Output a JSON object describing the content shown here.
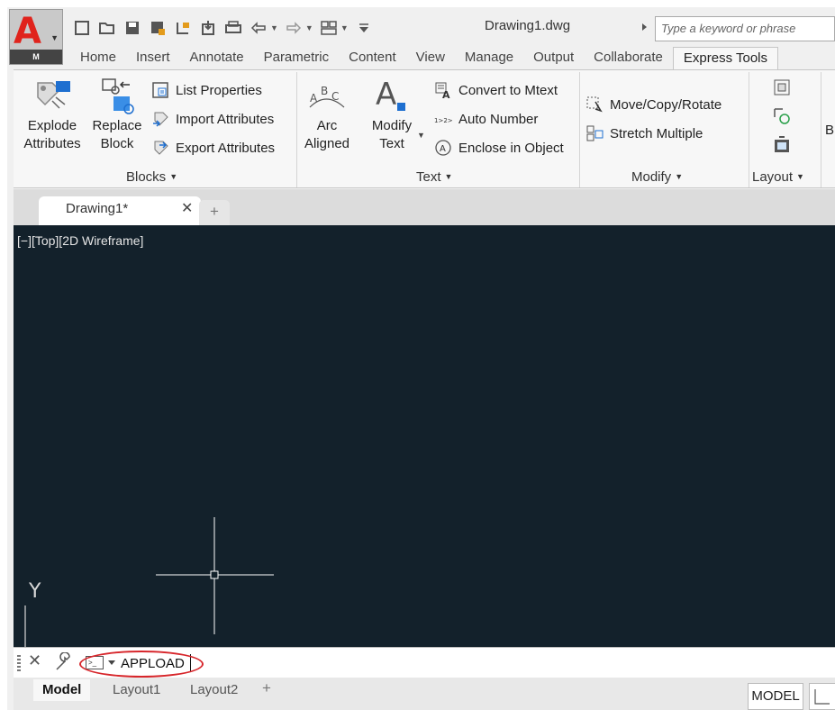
{
  "app": {
    "logo_letter": "A",
    "logo_badge": "M",
    "document_title": "Drawing1.dwg"
  },
  "search": {
    "placeholder": "Type a keyword or phrase"
  },
  "ribbon_tabs": [
    "Home",
    "Insert",
    "Annotate",
    "Parametric",
    "Content",
    "View",
    "Manage",
    "Output",
    "Collaborate",
    "Express Tools"
  ],
  "active_ribbon_tab": "Express Tools",
  "panels": {
    "blocks": {
      "title": "Blocks",
      "explode_line1": "Explode",
      "explode_line2": "Attributes",
      "replace_line1": "Replace",
      "replace_line2": "Block",
      "list_properties": "List Properties",
      "import_attributes": "Import Attributes",
      "export_attributes": "Export Attributes"
    },
    "text": {
      "title": "Text",
      "arc_line1": "Arc",
      "arc_line2": "Aligned",
      "modify_line1": "Modify",
      "modify_line2": "Text",
      "convert_to_mtext": "Convert to Mtext",
      "auto_number": "Auto Number",
      "enclose_in_object": "Enclose in Object"
    },
    "modify": {
      "title": "Modify",
      "move_copy_rotate": "Move/Copy/Rotate",
      "stretch_multiple": "Stretch Multiple"
    },
    "layout": {
      "title": "Layout"
    }
  },
  "document_tab": {
    "label": "Drawing1*",
    "add_label": "+"
  },
  "viewport": {
    "label": "[−][Top][2D Wireframe]",
    "ucs_axis": "Y"
  },
  "command_line": {
    "value": "APPLOAD"
  },
  "layout_tabs": [
    "Model",
    "Layout1",
    "Layout2"
  ],
  "status": {
    "model_button": "MODEL"
  },
  "colors": {
    "canvas_bg": "#13212b",
    "highlight_oval": "#d7262b",
    "logo_red": "#e0231c",
    "icon_blue": "#1e6fd0"
  }
}
